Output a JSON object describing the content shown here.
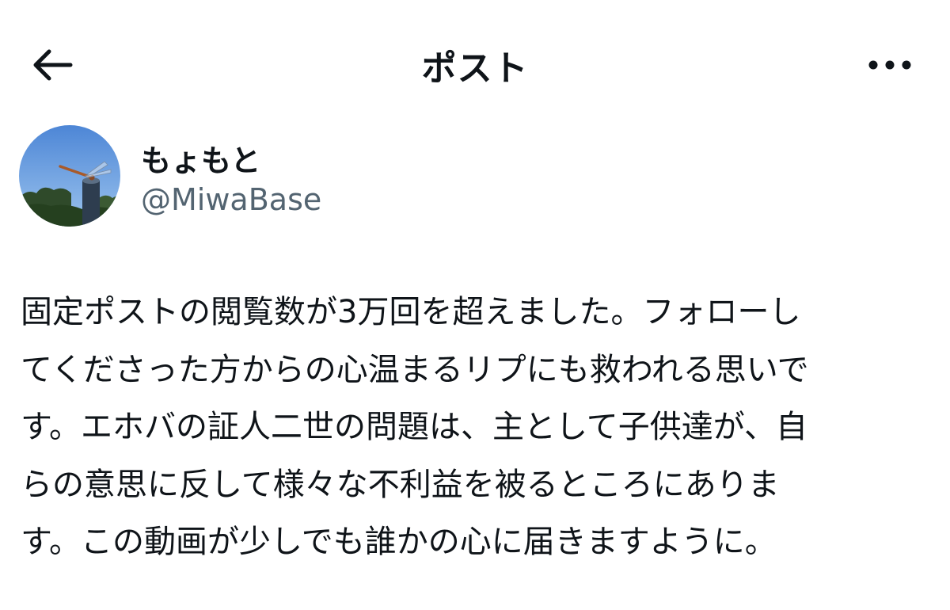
{
  "header": {
    "title": "ポスト",
    "back_icon": "arrow-left-icon",
    "more_icon": "more-horizontal-icon"
  },
  "author": {
    "display_name": "もょもと",
    "handle": "@MiwaBase",
    "avatar": "dragonfly-on-post-photo"
  },
  "post": {
    "text": "固定ポストの閲覧数が3万回を超えました。フォローし\nてくださった方からの心温まるリプにも救われる思いで\nす。エホバの証人二世の問題は、主として子供達が、自\nらの意思に反して様々な不利益を被るところにありま\nす。この動画が少しでも誰かの心に届きますように。"
  },
  "colors": {
    "text_primary": "#0f1419",
    "text_secondary": "#536471",
    "background": "#ffffff"
  }
}
